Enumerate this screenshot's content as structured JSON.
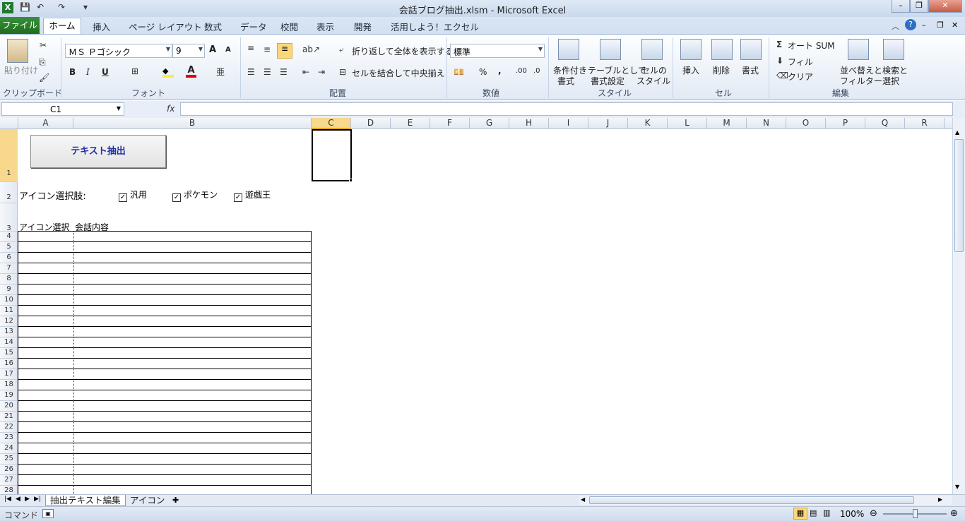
{
  "app": {
    "title": "会話ブログ抽出.xlsm  -  Microsoft Excel",
    "qat": {
      "save": "💾",
      "undo": "↶",
      "redo": "↷",
      "customize": "▾"
    },
    "window_controls": {
      "minimize": "–",
      "restore": "❐",
      "close": "✕"
    }
  },
  "ribbon_tabs": [
    "ファイル",
    "ホーム",
    "挿入",
    "ページ レイアウト",
    "数式",
    "データ",
    "校閲",
    "表示",
    "開発",
    "活用しよう！エクセル"
  ],
  "ribbon": {
    "clipboard": {
      "paste": "貼り付け",
      "label": "クリップボード"
    },
    "font": {
      "name": "ＭＳ Ｐゴシック",
      "size": "9",
      "bold": "B",
      "italic": "I",
      "underline": "U",
      "label": "フォント",
      "grow": "A",
      "shrink": "A"
    },
    "alignment": {
      "wrap": "折り返して全体を表示する",
      "merge": "セルを結合して中央揃え",
      "label": "配置"
    },
    "number": {
      "format": "標準",
      "percent": "%",
      "comma": ",",
      "inc": ".00",
      "dec": ".0",
      "label": "数値"
    },
    "styles": {
      "conditional": "条件付き",
      "conditional2": "書式",
      "table": "テーブルとして",
      "table2": "書式設定",
      "cell": "セルの",
      "cell2": "スタイル",
      "label": "スタイル"
    },
    "cells": {
      "insert": "挿入",
      "delete": "削除",
      "format": "書式",
      "label": "セル"
    },
    "editing": {
      "autosum": "オート SUM",
      "fill": "フィル",
      "clear": "クリア",
      "sort": "並べ替えと",
      "sort2": "フィルター",
      "find": "検索と",
      "find2": "選択",
      "label": "編集"
    }
  },
  "formula_bar": {
    "name_box": "C1",
    "fx": "fx",
    "formula": ""
  },
  "columns": [
    "A",
    "B",
    "C",
    "D",
    "E",
    "F",
    "G",
    "H",
    "I",
    "J",
    "K",
    "L",
    "M",
    "N",
    "O",
    "P",
    "Q",
    "R"
  ],
  "rows": [
    "1",
    "2",
    "3",
    "4",
    "5",
    "6",
    "7",
    "8",
    "9",
    "10",
    "11",
    "12",
    "13",
    "14",
    "15",
    "16",
    "17",
    "18",
    "19",
    "20",
    "21",
    "22",
    "23",
    "24",
    "25",
    "26",
    "27",
    "28"
  ],
  "sheet": {
    "button_label": "テキスト抽出",
    "icon_label": "アイコン選択肢:",
    "checkboxes": [
      {
        "label": "汎用",
        "checked": true
      },
      {
        "label": "ポケモン",
        "checked": true
      },
      {
        "label": "遊戯王",
        "checked": true
      }
    ],
    "header_a": "アイコン選択",
    "header_b": "会話内容"
  },
  "sheet_tabs": [
    "抽出テキスト編集",
    "アイコン"
  ],
  "status": {
    "mode": "コマンド",
    "zoom": "100%"
  }
}
